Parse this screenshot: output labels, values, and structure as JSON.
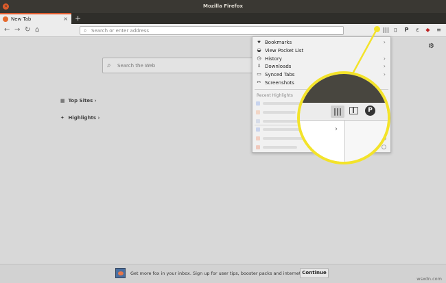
{
  "window": {
    "title": "Mozilla Firefox",
    "close_glyph": "×"
  },
  "tabs": [
    {
      "label": "New Tab",
      "close_glyph": "×"
    }
  ],
  "new_tab_glyph": "+",
  "nav": {
    "back_glyph": "←",
    "forward_glyph": "→",
    "reload_glyph": "↻",
    "home_glyph": "⌂",
    "url_placeholder": "Search or enter address",
    "toolbar_glyphs": {
      "library": "\\",
      "sidebar": "▯",
      "pocket": "P",
      "extension": "ε",
      "ublock": "◆",
      "menu": "≡"
    }
  },
  "newtab_page": {
    "web_search_placeholder": "Search the Web",
    "top_sites_label": "Top Sites",
    "highlights_label": "Highlights",
    "chevron": "›"
  },
  "library_menu": {
    "items": [
      {
        "label": "Bookmarks",
        "icon": "star-icon",
        "glyph": "★",
        "chevron": "›"
      },
      {
        "label": "View Pocket List",
        "icon": "pocket-icon",
        "glyph": "◒",
        "chevron": ""
      },
      {
        "label": "History",
        "icon": "clock-icon",
        "glyph": "◷",
        "chevron": "›"
      },
      {
        "label": "Downloads",
        "icon": "download-icon",
        "glyph": "⇩",
        "chevron": "›"
      },
      {
        "label": "Synced Tabs",
        "icon": "synced-tabs-icon",
        "glyph": "▭",
        "chevron": "›"
      },
      {
        "label": "Screenshots",
        "icon": "screenshot-icon",
        "glyph": "✂",
        "chevron": ""
      }
    ],
    "recent_highlights_label": "Recent Highlights",
    "highlight_favicon_colors": [
      "#c8d4ee",
      "#f2d6c6",
      "#d6dce8",
      "#c9d3ec",
      "#f3cfc2",
      "#f0c9bd"
    ]
  },
  "callout": {
    "pocket_glyph": "P",
    "library_glyph": "\\",
    "chevron": "›",
    "highlight_color": "#f3e32a"
  },
  "snippet": {
    "text": "Get more fox in your inbox. Sign up for user tips, booster packs and internet intel.",
    "button_label": "Continue"
  },
  "watermark": "wsxdn.com"
}
